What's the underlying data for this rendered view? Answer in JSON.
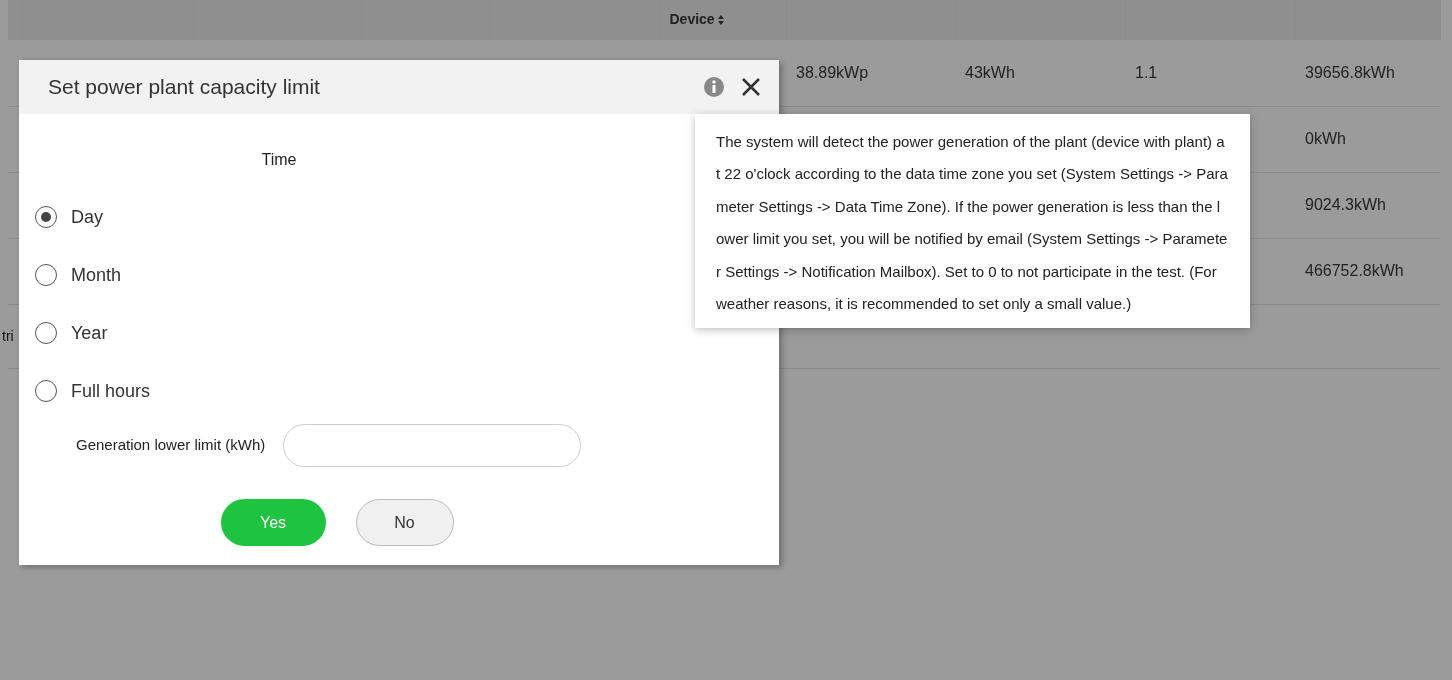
{
  "table": {
    "sortable_header": {
      "label": "Device",
      "sortable": true
    },
    "rows": [
      {
        "column_6": "38.89kWp",
        "column_7": "43kWh",
        "column_8": "1.1",
        "column_9": "39656.8kWh"
      },
      {
        "column_9": "0kWh"
      },
      {
        "column_9": "9024.3kWh"
      },
      {
        "column_9": "466752.8kWh"
      }
    ],
    "footer_text": "tri"
  },
  "dialog": {
    "title": "Set power plant capacity limit",
    "time_label": "Time",
    "options": [
      {
        "label": "Day",
        "selected": true
      },
      {
        "label": "Month",
        "selected": false
      },
      {
        "label": "Year",
        "selected": false
      },
      {
        "label": "Full hours",
        "selected": false
      }
    ],
    "limit_field": {
      "label": "Generation lower limit (kWh)"
    },
    "buttons": [
      {
        "label": "Yes",
        "kind": "primary"
      },
      {
        "label": "No",
        "kind": "secondary"
      }
    ]
  },
  "tooltip": {
    "text": "The system will detect the power generation of the plant (device with plant) at 22 o'clock according to the data time zone you set (System Settings -> Parameter Settings -> Data Time Zone). If the power generation is less than the lower limit you set, you will be notified by email (System Settings -> Parameter Settings -> Notification Mailbox). Set to 0 to not participate in the test. (For weather reasons, it is recommended to set only a small value.)"
  }
}
